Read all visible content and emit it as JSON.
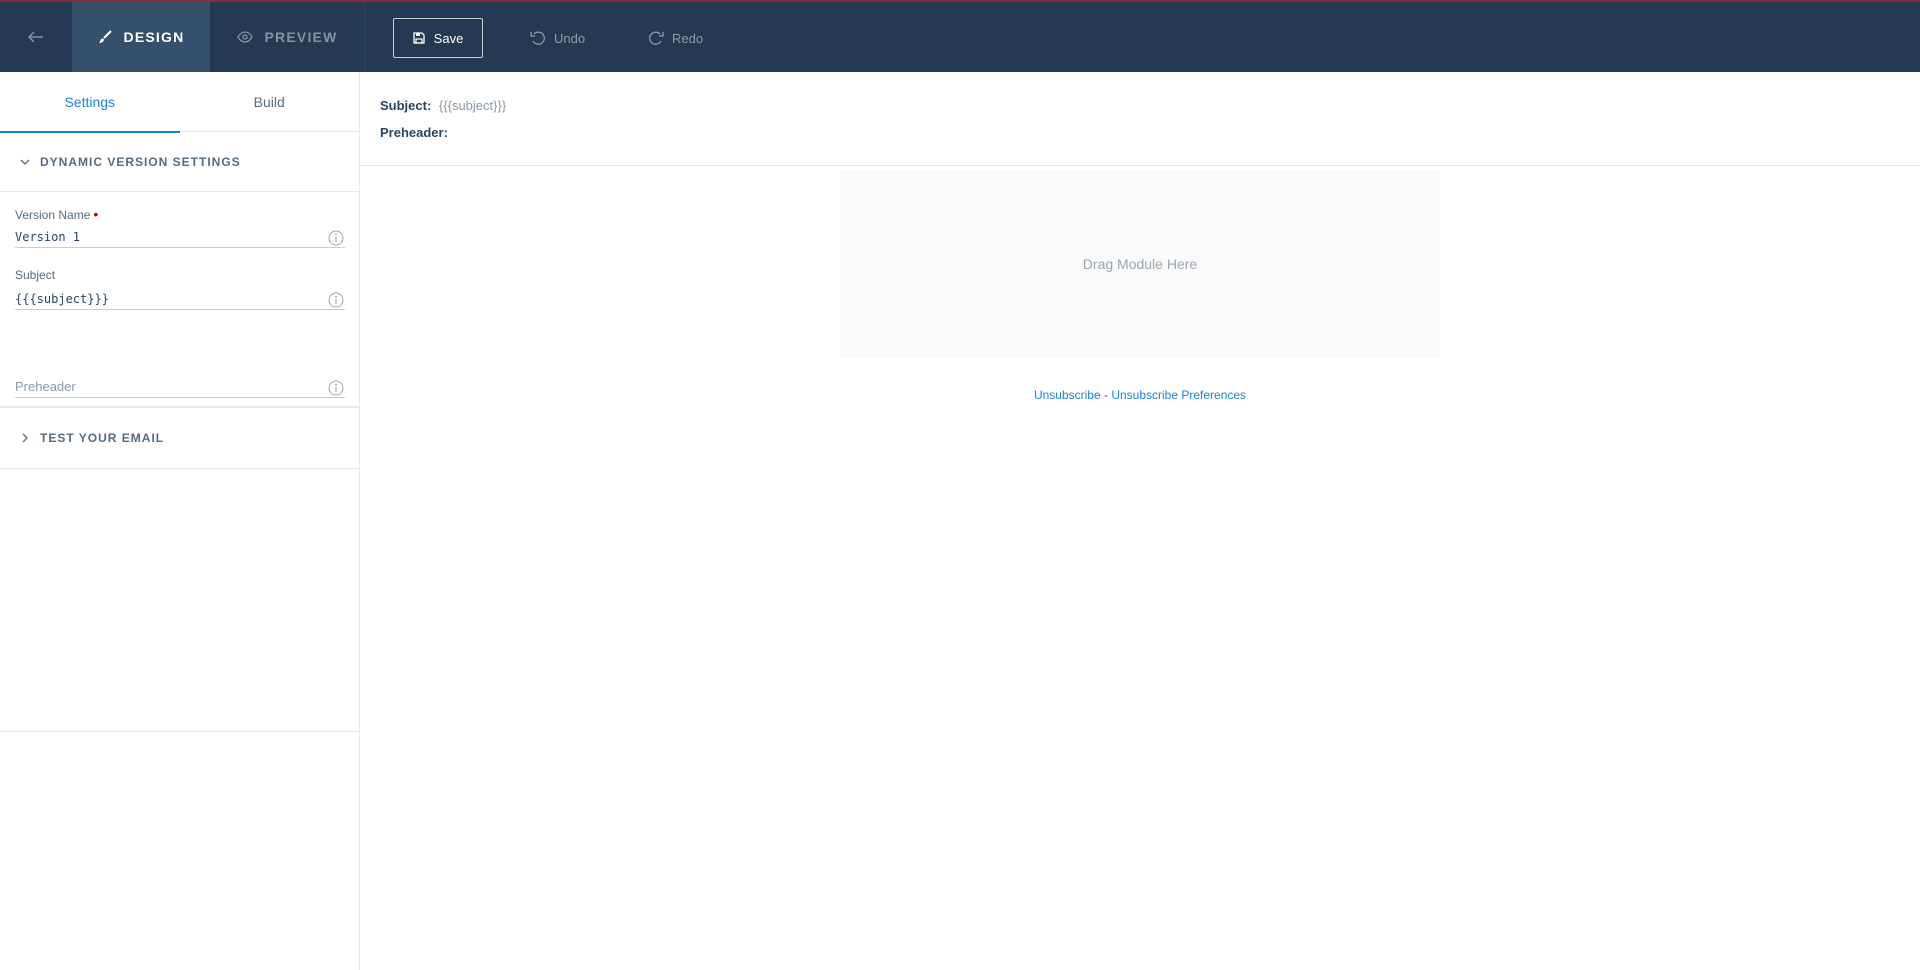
{
  "topbar": {
    "tabs": [
      {
        "label": "DESIGN",
        "active": true
      },
      {
        "label": "PREVIEW",
        "active": false
      }
    ],
    "save_label": "Save",
    "undo_label": "Undo",
    "redo_label": "Redo"
  },
  "sidebar": {
    "tabs": [
      {
        "label": "Settings",
        "active": true
      },
      {
        "label": "Build",
        "active": false
      }
    ],
    "dynamic_section": {
      "title": "DYNAMIC VERSION SETTINGS",
      "expanded": true,
      "fields": {
        "version_name": {
          "label": "Version Name",
          "required_mark": "•",
          "value": "Version 1"
        },
        "subject": {
          "label": "Subject",
          "value": "{{{subject}}}"
        },
        "preheader": {
          "placeholder": "Preheader",
          "value": ""
        }
      }
    },
    "test_section": {
      "title": "TEST YOUR EMAIL",
      "expanded": false
    }
  },
  "canvas": {
    "subject_label": "Subject:",
    "subject_value": "{{{subject}}}",
    "preheader_label": "Preheader:",
    "dropzone_text": "Drag Module Here",
    "unsubscribe_label": "Unsubscribe",
    "separator": " - ",
    "preferences_label": "Unsubscribe Preferences"
  },
  "colors": {
    "topbar_bg": "#233a52",
    "active_tab_bg": "#34506b",
    "accent_blue": "#1a82e2",
    "text_primary": "#294661",
    "required_red": "#cc0000"
  },
  "icons": {
    "back": "arrow-left-icon",
    "design": "brush-icon",
    "preview": "eye-icon",
    "save": "floppy-disk-icon",
    "undo": "undo-icon",
    "redo": "redo-icon",
    "expanded": "chevron-down-icon",
    "collapsed": "chevron-right-icon",
    "info": "info-circle-icon"
  }
}
